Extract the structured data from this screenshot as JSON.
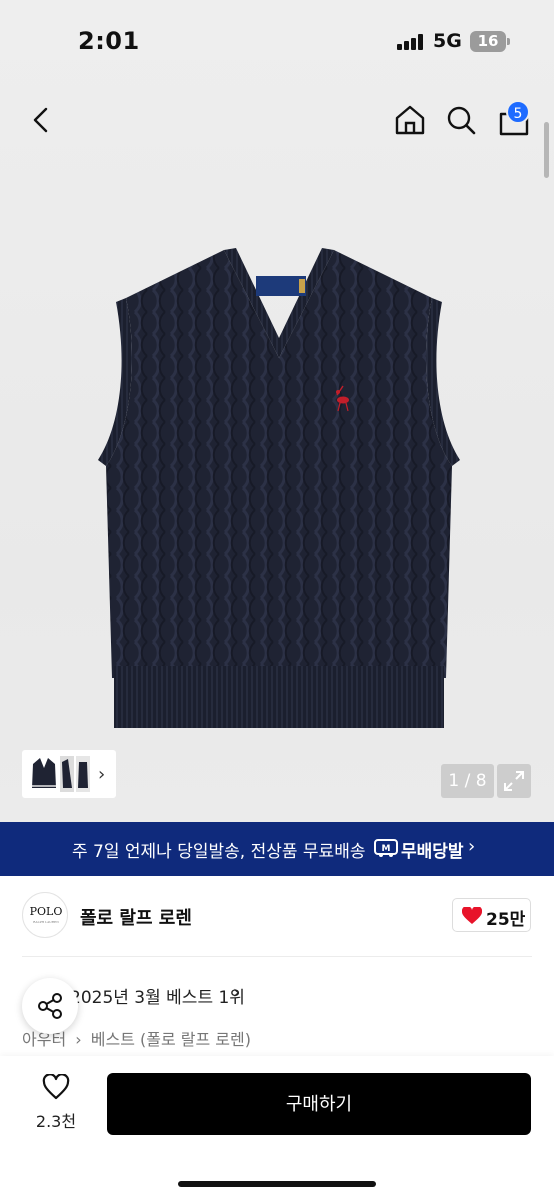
{
  "status_bar": {
    "time": "2:01",
    "network": "5G",
    "battery": "16"
  },
  "header": {
    "cart_count": "5"
  },
  "gallery": {
    "pager": "1 / 8"
  },
  "delivery_banner": {
    "text": "주 7일 언제나 당일발송, 전상품 무료배송",
    "brand": "무배당발"
  },
  "brand": {
    "logo_text": "POLO",
    "logo_sub": "RALPH LAUREN",
    "name": "폴로 랄프 로렌",
    "likes": "25만"
  },
  "ranking": {
    "label": "2025년 3월 베스트 1위"
  },
  "breadcrumb": {
    "category": "아우터",
    "sub": "베스트 (폴로 랄프 로렌)"
  },
  "bottom_bar": {
    "wish_count": "2.3천",
    "buy_label": "구매하기"
  },
  "colors": {
    "banner_bg": "#0f2a7c",
    "badge": "#1e6bff",
    "heart": "#e8132a",
    "vest": "#1f2333"
  }
}
